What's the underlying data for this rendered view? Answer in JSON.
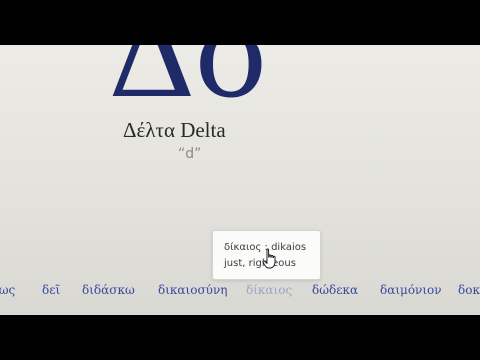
{
  "entry": {
    "glyph": "Δδ",
    "name": "Δέλτα Delta",
    "transliteration": "“d”"
  },
  "tooltip": {
    "word": "δίκαιος : dikaios",
    "meaning": "just, righteous"
  },
  "vocab": [
    {
      "word": "ιως"
    },
    {
      "word": "δεῖ"
    },
    {
      "word": "διδάσκω"
    },
    {
      "word": "δικαιοσύνη"
    },
    {
      "word": "δίκαιος"
    },
    {
      "word": "δώδεκα"
    },
    {
      "word": "δαιμόνιον"
    },
    {
      "word": "δοκ"
    }
  ],
  "colors": {
    "glyph": "#1f2a68",
    "link": "#38479a",
    "hovered_link": "#9ba3c6"
  },
  "cursor": {
    "icon": "hand-pointer-icon"
  }
}
